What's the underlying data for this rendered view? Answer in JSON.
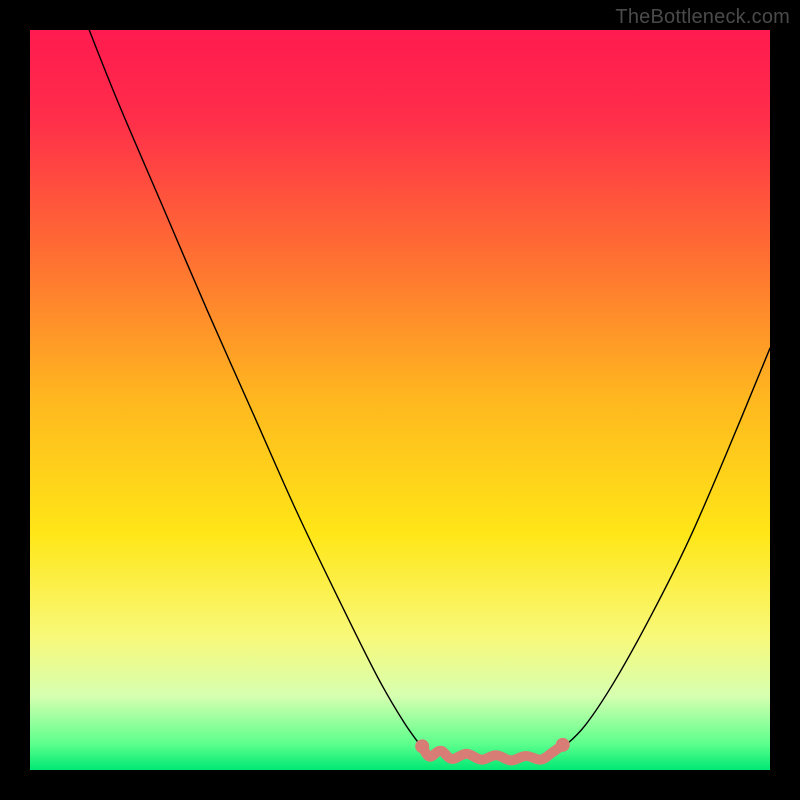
{
  "watermark": "TheBottleneck.com",
  "chart_data": {
    "type": "line",
    "title": "",
    "xlabel": "",
    "ylabel": "",
    "xlim": [
      0,
      100
    ],
    "ylim": [
      0,
      100
    ],
    "grid": false,
    "legend": false,
    "background_gradient_stops": [
      {
        "offset": 0.0,
        "color": "#ff1a4f"
      },
      {
        "offset": 0.12,
        "color": "#ff2e4a"
      },
      {
        "offset": 0.3,
        "color": "#ff6d33"
      },
      {
        "offset": 0.5,
        "color": "#ffb81f"
      },
      {
        "offset": 0.68,
        "color": "#ffe617"
      },
      {
        "offset": 0.82,
        "color": "#f8f97a"
      },
      {
        "offset": 0.9,
        "color": "#d6ffb0"
      },
      {
        "offset": 0.965,
        "color": "#5cff8c"
      },
      {
        "offset": 1.0,
        "color": "#00e874"
      }
    ],
    "series": [
      {
        "name": "curve-left",
        "stroke": "#000000",
        "stroke_width": 1.4,
        "points": [
          {
            "x": 8.0,
            "y": 100.0
          },
          {
            "x": 12.0,
            "y": 90.0
          },
          {
            "x": 18.0,
            "y": 76.0
          },
          {
            "x": 24.0,
            "y": 62.0
          },
          {
            "x": 30.0,
            "y": 48.5
          },
          {
            "x": 36.0,
            "y": 35.0
          },
          {
            "x": 42.0,
            "y": 22.5
          },
          {
            "x": 47.0,
            "y": 12.5
          },
          {
            "x": 50.5,
            "y": 6.5
          },
          {
            "x": 53.0,
            "y": 3.0
          }
        ]
      },
      {
        "name": "curve-right",
        "stroke": "#000000",
        "stroke_width": 1.4,
        "points": [
          {
            "x": 72.0,
            "y": 3.0
          },
          {
            "x": 75.0,
            "y": 6.0
          },
          {
            "x": 79.0,
            "y": 12.0
          },
          {
            "x": 84.0,
            "y": 21.0
          },
          {
            "x": 89.0,
            "y": 31.0
          },
          {
            "x": 94.0,
            "y": 42.5
          },
          {
            "x": 100.0,
            "y": 57.0
          }
        ]
      },
      {
        "name": "bottom-squiggle",
        "stroke": "#d87d75",
        "stroke_width": 10,
        "points": [
          {
            "x": 53.0,
            "y": 3.2
          },
          {
            "x": 54.0,
            "y": 1.8
          },
          {
            "x": 55.5,
            "y": 2.6
          },
          {
            "x": 57.0,
            "y": 1.5
          },
          {
            "x": 59.0,
            "y": 2.2
          },
          {
            "x": 61.0,
            "y": 1.4
          },
          {
            "x": 63.0,
            "y": 2.0
          },
          {
            "x": 65.0,
            "y": 1.3
          },
          {
            "x": 67.0,
            "y": 1.9
          },
          {
            "x": 69.0,
            "y": 1.4
          },
          {
            "x": 70.5,
            "y": 2.3
          },
          {
            "x": 72.0,
            "y": 3.4
          }
        ]
      },
      {
        "name": "bottom-dot-left",
        "type": "dot",
        "fill": "#d87d75",
        "r": 7,
        "cx": 53.0,
        "cy": 3.2
      },
      {
        "name": "bottom-dot-right",
        "type": "dot",
        "fill": "#d87d75",
        "r": 7,
        "cx": 72.0,
        "cy": 3.4
      }
    ]
  }
}
